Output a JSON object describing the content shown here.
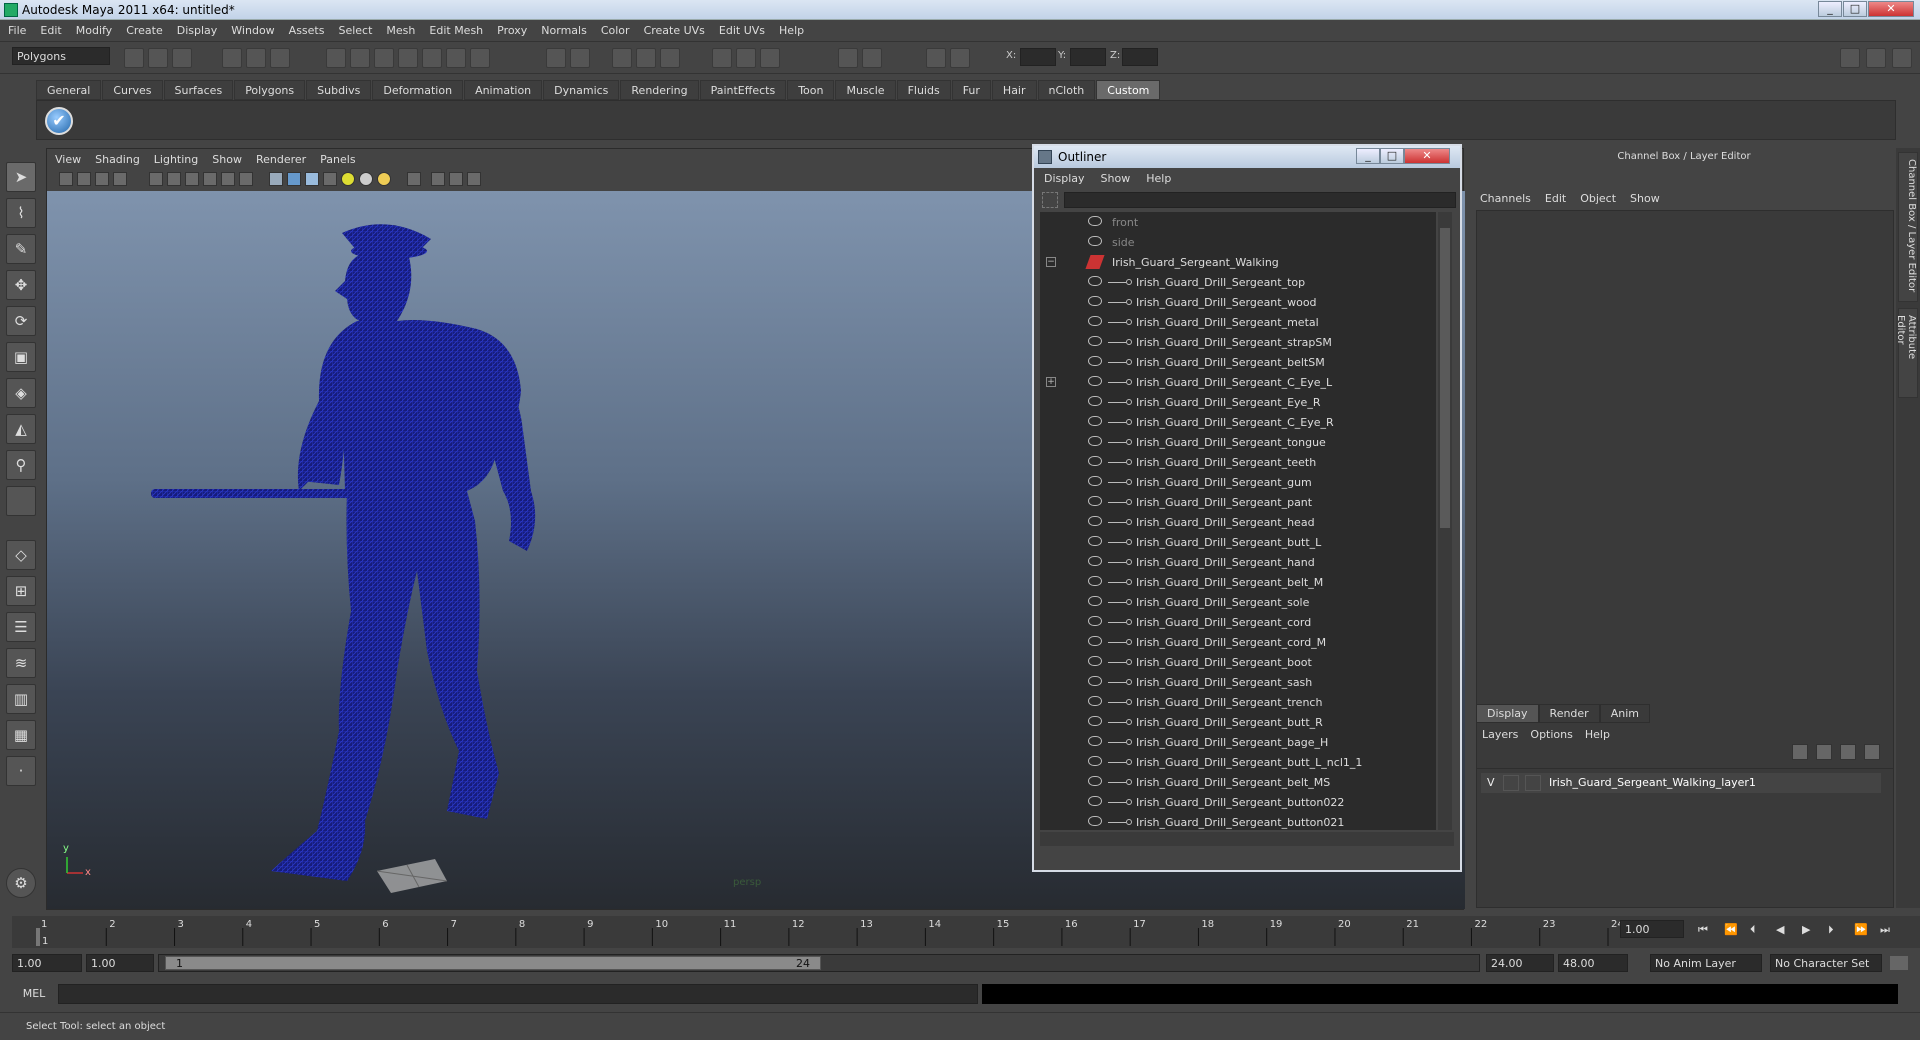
{
  "window": {
    "title": "Autodesk Maya 2011 x64: untitled*"
  },
  "menubar": [
    "File",
    "Edit",
    "Modify",
    "Create",
    "Display",
    "Window",
    "Assets",
    "Select",
    "Mesh",
    "Edit Mesh",
    "Proxy",
    "Normals",
    "Color",
    "Create UVs",
    "Edit UVs",
    "Help"
  ],
  "statusline": {
    "mode": "Polygons",
    "x_label": "X:",
    "y_label": "Y:",
    "z_label": "Z:"
  },
  "shelf": {
    "tabs": [
      "General",
      "Curves",
      "Surfaces",
      "Polygons",
      "Subdivs",
      "Deformation",
      "Animation",
      "Dynamics",
      "Rendering",
      "PaintEffects",
      "Toon",
      "Muscle",
      "Fluids",
      "Fur",
      "Hair",
      "nCloth",
      "Custom"
    ],
    "active_tab": "Custom"
  },
  "viewport": {
    "menu": [
      "View",
      "Shading",
      "Lighting",
      "Show",
      "Renderer",
      "Panels"
    ],
    "camera_label": "persp",
    "axis_y": "y",
    "axis_x": "x"
  },
  "outliner": {
    "title": "Outliner",
    "menu": [
      "Display",
      "Show",
      "Help"
    ],
    "cameras": [
      "front",
      "side"
    ],
    "root": "Irish_Guard_Sergeant_Walking",
    "children": [
      "Irish_Guard_Drill_Sergeant_top",
      "Irish_Guard_Drill_Sergeant_wood",
      "Irish_Guard_Drill_Sergeant_metal",
      "Irish_Guard_Drill_Sergeant_strapSM",
      "Irish_Guard_Drill_Sergeant_beltSM",
      "Irish_Guard_Drill_Sergeant_C_Eye_L",
      "Irish_Guard_Drill_Sergeant_Eye_R",
      "Irish_Guard_Drill_Sergeant_C_Eye_R",
      "Irish_Guard_Drill_Sergeant_tongue",
      "Irish_Guard_Drill_Sergeant_teeth",
      "Irish_Guard_Drill_Sergeant_gum",
      "Irish_Guard_Drill_Sergeant_pant",
      "Irish_Guard_Drill_Sergeant_head",
      "Irish_Guard_Drill_Sergeant_butt_L",
      "Irish_Guard_Drill_Sergeant_hand",
      "Irish_Guard_Drill_Sergeant_belt_M",
      "Irish_Guard_Drill_Sergeant_sole",
      "Irish_Guard_Drill_Sergeant_cord",
      "Irish_Guard_Drill_Sergeant_cord_M",
      "Irish_Guard_Drill_Sergeant_boot",
      "Irish_Guard_Drill_Sergeant_sash",
      "Irish_Guard_Drill_Sergeant_trench",
      "Irish_Guard_Drill_Sergeant_butt_R",
      "Irish_Guard_Drill_Sergeant_bage_H",
      "Irish_Guard_Drill_Sergeant_butt_L_ncl1_1",
      "Irish_Guard_Drill_Sergeant_belt_MS",
      "Irish_Guard_Drill_Sergeant_button022",
      "Irish_Guard_Drill_Sergeant_button021"
    ]
  },
  "channel_box": {
    "title": "Channel Box / Layer Editor",
    "menu": [
      "Channels",
      "Edit",
      "Object",
      "Show"
    ],
    "layer_tabs": [
      "Display",
      "Render",
      "Anim"
    ],
    "layer_menu": [
      "Layers",
      "Options",
      "Help"
    ],
    "layer_visibility": "V",
    "layer_name": "Irish_Guard_Sergeant_Walking_layer1",
    "side_tabs": [
      "Channel Box / Layer Editor",
      "Attribute Editor"
    ]
  },
  "timeline": {
    "ticks": [
      "1",
      "2",
      "3",
      "4",
      "5",
      "6",
      "7",
      "8",
      "9",
      "10",
      "11",
      "12",
      "13",
      "14",
      "15",
      "16",
      "17",
      "18",
      "19",
      "20",
      "21",
      "22",
      "23",
      "24"
    ],
    "current_frame": "1",
    "current_time_field": "1.00"
  },
  "range": {
    "start": "1.00",
    "playback_start": "1.00",
    "slider_start": "1",
    "slider_end": "24",
    "playback_end": "24.00",
    "end": "48.00",
    "anim_layer": "No Anim Layer",
    "character_set": "No Character Set"
  },
  "command": {
    "mel_label": "MEL"
  },
  "help_line": "Select Tool: select an object"
}
